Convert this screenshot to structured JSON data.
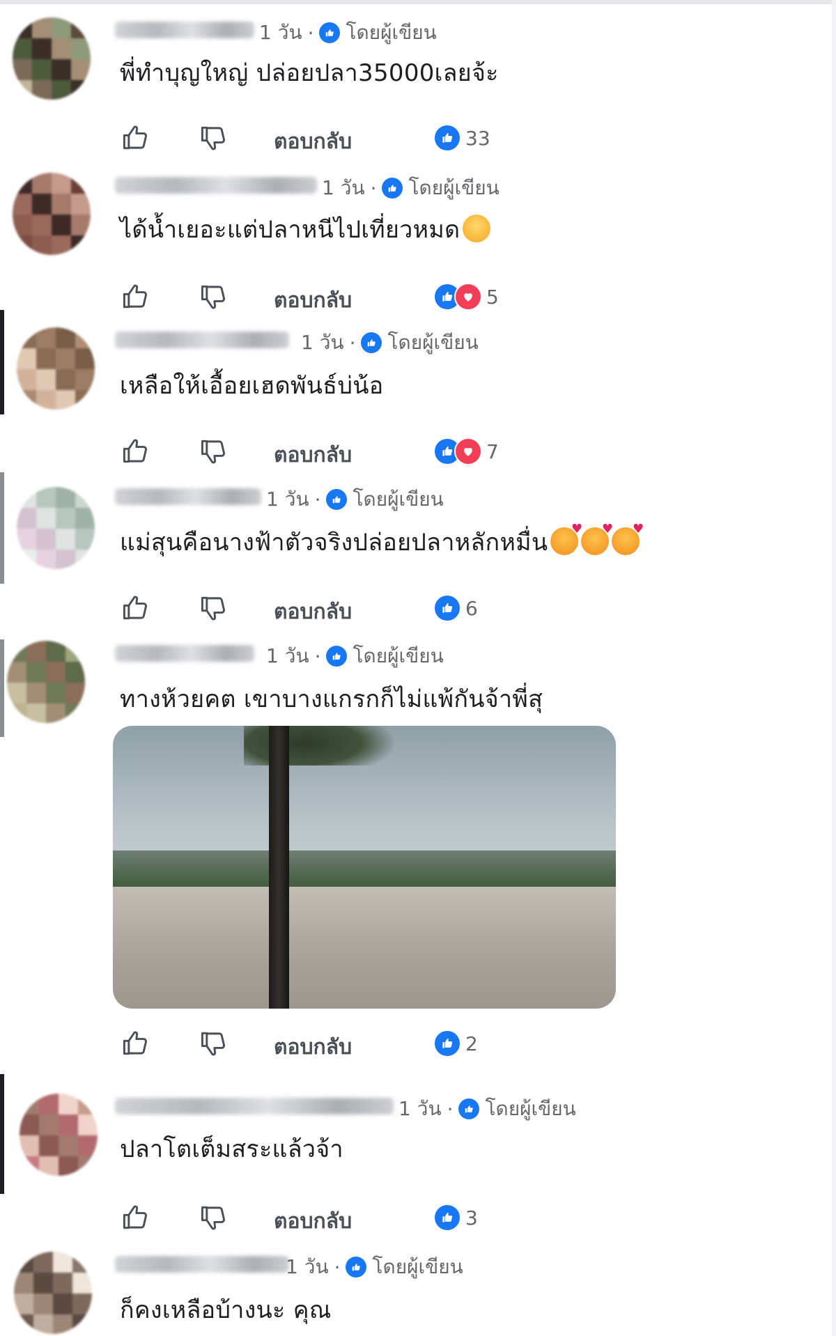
{
  "labels": {
    "time": "1 วัน",
    "separator": "·",
    "author_badge": "โดยผู้เขียน",
    "reply": "ตอบกลับ"
  },
  "colors": {
    "badge": "#1877f2",
    "like": "#1877f2",
    "love": "#f33e58",
    "meta_text": "#65676b"
  },
  "icons": {
    "like_button": "thumbs-up-icon",
    "dislike_button": "thumbs-down-icon",
    "author_badge": "author-badge-icon",
    "reaction_like": "like-reaction-icon",
    "reaction_love": "love-reaction-icon"
  },
  "comments": [
    {
      "text": "พี่ทำบุญใหญ่ ปล่อยปลา35000เลยจ้ะ",
      "reactions": [
        "like"
      ],
      "count": "33"
    },
    {
      "text": "ได้น้ำเยอะแต่ปลาหนีไปเที่ยวหมด",
      "emoji": "smile",
      "reactions": [
        "like",
        "love"
      ],
      "count": "5"
    },
    {
      "text": "เหลือให้เอื้อยเฮดพันธ์บ่น้อ",
      "reactions": [
        "like",
        "love"
      ],
      "count": "7"
    },
    {
      "text": "แม่สุนคือนางฟ้าตัวจริงปล่อยปลาหลักหมื่น",
      "emoji": "love",
      "emoji_count": 3,
      "reactions": [
        "like"
      ],
      "count": "6"
    },
    {
      "text": "ทางห้วยคต เขาบางแกรกก็ไม่แพ้กันจ้าพี่สุ",
      "has_photo": true,
      "reactions": [
        "like"
      ],
      "count": "2"
    },
    {
      "text": "ปลาโตเต็มสระแล้วจ้า",
      "reactions": [
        "like"
      ],
      "count": "3"
    },
    {
      "text": "ก็คงเหลือบ้างนะ คุณ",
      "reactions": [],
      "count": ""
    }
  ]
}
